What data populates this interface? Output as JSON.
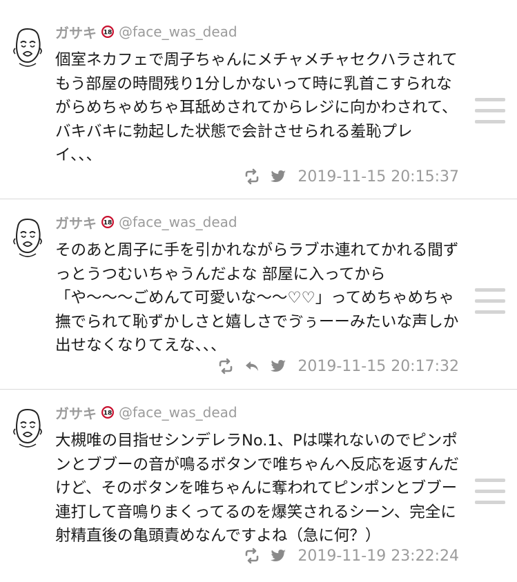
{
  "tweets": [
    {
      "name": "ガサキ",
      "handle": "@face_was_dead",
      "text": "個室ネカフェで周子ちゃんにメチャメチャセクハラされて\nもう部屋の時間残り1分しかないって時に乳首こすられな\nがらめちゃめちゃ耳舐めされてからレジに向かわされて、\nバキバキに勃起した状態で会計させられる羞恥プレ\nイ、、、",
      "timestamp": "2019-11-15 20:15:37",
      "icons": [
        "retweet-icon",
        "twitter-bird-icon"
      ]
    },
    {
      "name": "ガサキ",
      "handle": "@face_was_dead",
      "text": "そのあと周子に手を引かれながらラブホ連れてかれる間ず\nっとうつむいちゃうんだよな 部屋に入ってから\n「や〜〜〜ごめんて可愛いな〜〜♡♡」ってめちゃめちゃ\n撫でられて恥ずかしさと嬉しさでゔぅーーみたいな声しか\n出せなくなりてえな、、、",
      "timestamp": "2019-11-15 20:17:32",
      "icons": [
        "retweet-icon",
        "reply-icon",
        "twitter-bird-icon"
      ]
    },
    {
      "name": "ガサキ",
      "handle": "@face_was_dead",
      "text": "大槻唯の目指せシンデレラNo.1、Pは喋れないのでピンポ\nンとブブーの音が鳴るボタンで唯ちゃんへ反応を返すんだ\nけど、そのボタンを唯ちゃんに奪われてピンポンとブブー\n連打して音鳴りまくってるのを爆笑されるシーン、完全に\n射精直後の亀頭責めなんですよね（急に何？）",
      "timestamp": "2019-11-19 23:22:24",
      "icons": [
        "retweet-icon",
        "twitter-bird-icon"
      ]
    }
  ],
  "colors": {
    "muted": "#9b9b9b",
    "text": "#1a1a1a",
    "divider": "#d9d9d9",
    "menu": "#d4d4d4",
    "badge": "#c8102e"
  }
}
